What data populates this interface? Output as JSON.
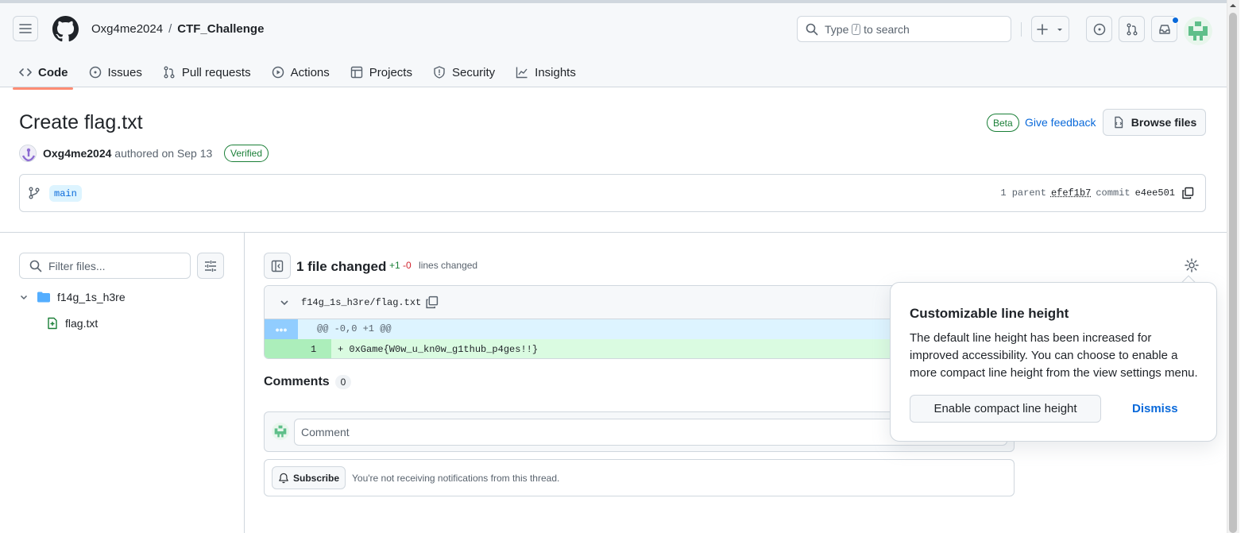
{
  "header": {
    "owner": "Oxg4me2024",
    "separator": "/",
    "repo": "CTF_Challenge",
    "search_prefix": "Type",
    "search_key": "/",
    "search_suffix": "to search"
  },
  "nav": {
    "tabs": [
      {
        "label": "Code",
        "icon": "code-icon",
        "active": true
      },
      {
        "label": "Issues",
        "icon": "issue-opened-icon"
      },
      {
        "label": "Pull requests",
        "icon": "git-pull-request-icon"
      },
      {
        "label": "Actions",
        "icon": "play-icon"
      },
      {
        "label": "Projects",
        "icon": "table-icon"
      },
      {
        "label": "Security",
        "icon": "shield-icon"
      },
      {
        "label": "Insights",
        "icon": "graph-icon"
      }
    ]
  },
  "commit": {
    "title": "Create flag.txt",
    "beta": "Beta",
    "feedback": "Give feedback",
    "browse": "Browse files",
    "author": "Oxg4me2024",
    "authored": "authored on Sep 13",
    "verified": "Verified",
    "branch": "main",
    "parent_label": "1 parent",
    "parent_sha": "efef1b7",
    "commit_label": "commit",
    "commit_sha": "e4ee501"
  },
  "tree": {
    "filter_placeholder": "Filter files...",
    "folder": "f14g_1s_h3re",
    "file": "flag.txt"
  },
  "diff": {
    "files_changed": "1 file changed",
    "additions": "+1",
    "deletions": "-0",
    "lines_changed": "lines changed",
    "filename": "f14g_1s_h3re/flag.txt",
    "hunk_button": "•••",
    "hunk": "@@ -0,0 +1 @@",
    "line_number": "1",
    "added_line": "+ 0xGame{W0w_u_kn0w_g1thub_p4ges!!}"
  },
  "comments": {
    "title": "Comments",
    "count": "0",
    "placeholder": "Comment",
    "subscribe": "Subscribe",
    "subscribe_note": "You're not receiving notifications from this thread."
  },
  "popover": {
    "title": "Customizable line height",
    "body": "The default line height has been increased for improved accessibility. You can choose to enable a more compact line height from the view settings menu.",
    "enable": "Enable compact line height",
    "dismiss": "Dismiss"
  },
  "colors": {
    "accent": "#0969da",
    "success": "#1a7f37",
    "danger": "#d1242f",
    "active_tab": "#fd8c73"
  }
}
